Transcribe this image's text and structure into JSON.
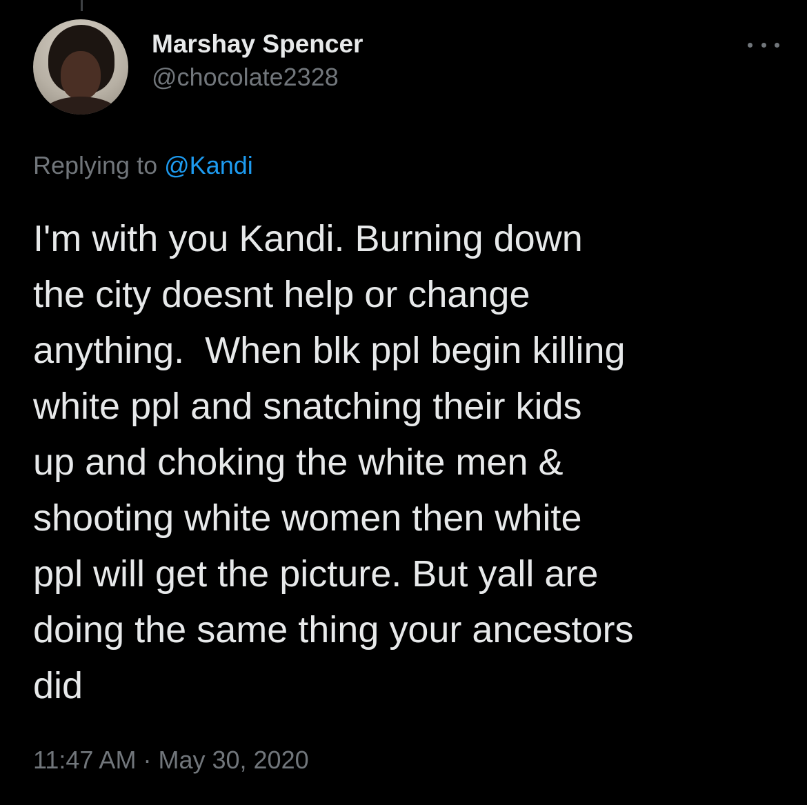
{
  "author": {
    "display_name": "Marshay Spencer",
    "handle": "@chocolate2328"
  },
  "reply_context": {
    "prefix": "Replying to",
    "mention": "@Kandi"
  },
  "tweet": {
    "text_lines": [
      "I'm with you Kandi. Burning down",
      "the city doesnt help or change",
      "anything.  When blk ppl begin killing",
      "white ppl and snatching their kids",
      "up and choking the white men &",
      "shooting white women then white",
      "ppl will get the picture. But yall are",
      "doing the same thing your ancestors",
      "did"
    ],
    "time": "11:47 AM",
    "separator": "·",
    "date": "May 30, 2020"
  },
  "icons": {
    "more": "more-horizontal-icon",
    "avatar": "profile-avatar"
  },
  "colors": {
    "background": "#000000",
    "text_primary": "#e7e9ea",
    "text_secondary": "#71767b",
    "accent_link": "#1d9bf0"
  }
}
